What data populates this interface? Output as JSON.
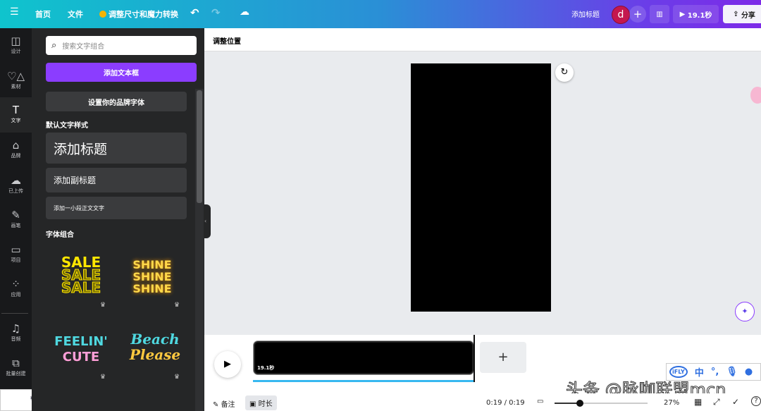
{
  "topbar": {
    "menu_icon": "hamburger-icon",
    "home": "首页",
    "file": "文件",
    "resize": "调整尺寸和魔力转换",
    "add_title": "添加标题",
    "avatar": "d",
    "add": "+",
    "duration": "19.1秒",
    "share": "分享",
    "accent": "#7d2ae8"
  },
  "rail": [
    {
      "label": "设计",
      "icon": "layout-icon"
    },
    {
      "label": "素材",
      "icon": "shapes-icon"
    },
    {
      "label": "文字",
      "icon": "text-icon"
    },
    {
      "label": "品牌",
      "icon": "brand-icon"
    },
    {
      "label": "已上传",
      "icon": "upload-cloud-icon"
    },
    {
      "label": "画笔",
      "icon": "pen-icon"
    },
    {
      "label": "项目",
      "icon": "folder-icon"
    },
    {
      "label": "应用",
      "icon": "apps-grid-icon"
    },
    {
      "label": "音频",
      "icon": "music-icon"
    },
    {
      "label": "批量创建",
      "icon": "bulk-create-icon"
    }
  ],
  "panel": {
    "search_placeholder": "搜索文字组合",
    "add_textbox": "添加文本框",
    "brand_fonts": "设置你的品牌字体",
    "default_styles": "默认文字样式",
    "heading": "添加标题",
    "subheading": "添加副标题",
    "body": "添加一小段正文文字",
    "combos": "字体组合",
    "combo_items": [
      {
        "lines": [
          "SALE",
          "SALE",
          "SALE"
        ]
      },
      {
        "lines": [
          "SHINE",
          "SHINE",
          "SHINE"
        ]
      },
      {
        "lines": [
          "FEELIN'",
          "CUTE"
        ]
      },
      {
        "lines": [
          "Beach",
          "Please"
        ]
      }
    ]
  },
  "canvas": {
    "header": "调整位置"
  },
  "timeline": {
    "clip_duration": "19.1秒",
    "add": "+"
  },
  "bottom": {
    "notes": "备注",
    "duration": "时长",
    "time": "0:19 / 0:19",
    "zoom": "27%",
    "zoom_level": 27,
    "help": "?"
  },
  "watermark": "头条 @脉咖联盟mcn",
  "ime": [
    "中"
  ]
}
